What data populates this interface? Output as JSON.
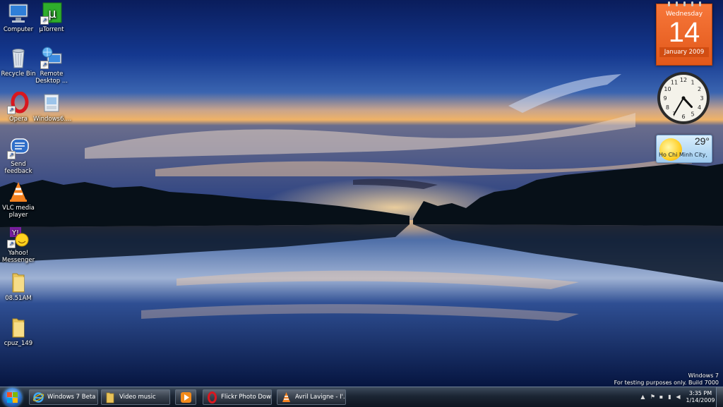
{
  "desktop_icons": [
    {
      "label": "Computer"
    },
    {
      "label": "µTorrent"
    },
    {
      "label": "Recycle Bin"
    },
    {
      "label": "Remote Desktop ..."
    },
    {
      "label": "Opera"
    },
    {
      "label": "Windows6...."
    },
    {
      "label": "Send feedback"
    },
    {
      "label": "VLC media player"
    },
    {
      "label": "Yahoo! Messenger"
    },
    {
      "label": "08.51AM"
    },
    {
      "label": "cpuz_149"
    }
  ],
  "gadgets": {
    "calendar": {
      "weekday": "Wednesday",
      "day": "14",
      "month_year": "January 2009"
    },
    "clock": {
      "hour": 4,
      "minute": 35
    },
    "weather": {
      "temperature": "29°",
      "city": "Ho Chi Minh City, ..."
    }
  },
  "watermark": {
    "line1": "Windows 7",
    "line2": "For testing purposes only. Build 7000"
  },
  "taskbar": {
    "buttons": [
      {
        "label": "Windows 7 Beta C...",
        "icon": "ie-icon"
      },
      {
        "label": "Video music",
        "icon": "folder-icon"
      },
      {
        "label": "",
        "icon": "media-player-icon"
      },
      {
        "label": "Flickr Photo Dow...",
        "icon": "opera-icon"
      },
      {
        "label": "Avril Lavigne - I'...",
        "icon": "vlc-icon"
      }
    ],
    "time": "3:35 PM",
    "date": "1/14/2009"
  },
  "colors": {
    "accent": "#e2581a",
    "taskbar": "#1b2533"
  }
}
